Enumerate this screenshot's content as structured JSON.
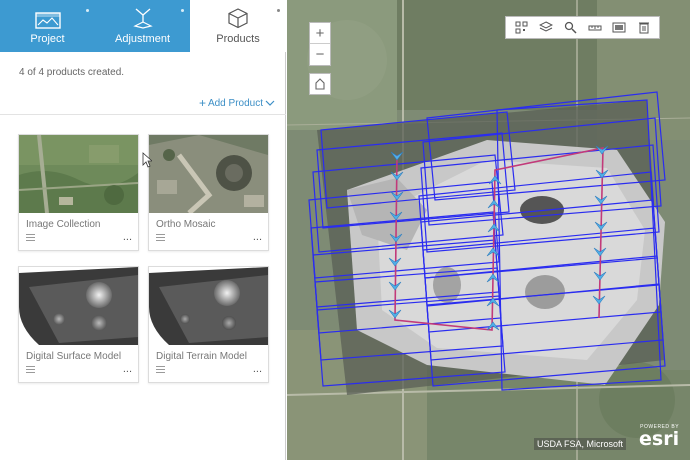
{
  "tabs": [
    {
      "label": "Project",
      "icon": "project-icon"
    },
    {
      "label": "Adjustment",
      "icon": "adjustment-icon"
    },
    {
      "label": "Products",
      "icon": "cube-icon",
      "active": true
    }
  ],
  "status": "4 of 4 products created.",
  "add_product": "Add Product",
  "products": [
    {
      "title": "Image Collection",
      "more": "..."
    },
    {
      "title": "Ortho Mosaic",
      "more": "..."
    },
    {
      "title": "Digital Surface Model",
      "more": "..."
    },
    {
      "title": "Digital Terrain Model",
      "more": "..."
    }
  ],
  "map": {
    "zoom_in": "+",
    "zoom_out": "−",
    "toolbar_icons": [
      "qr-grid-icon",
      "layers-icon",
      "search-icon",
      "measure-icon",
      "image-icon",
      "delete-icon"
    ],
    "attribution": "USDA FSA, Microsoft",
    "brand_powered": "POWERED BY",
    "brand": "esri"
  },
  "colors": {
    "tab_blue": "#3d9ad1",
    "link_blue": "#3d8fc6",
    "footprint_blue": "#2a2cf0",
    "flight_line": "#c23a7a",
    "waypoint": "#52b0e8"
  }
}
